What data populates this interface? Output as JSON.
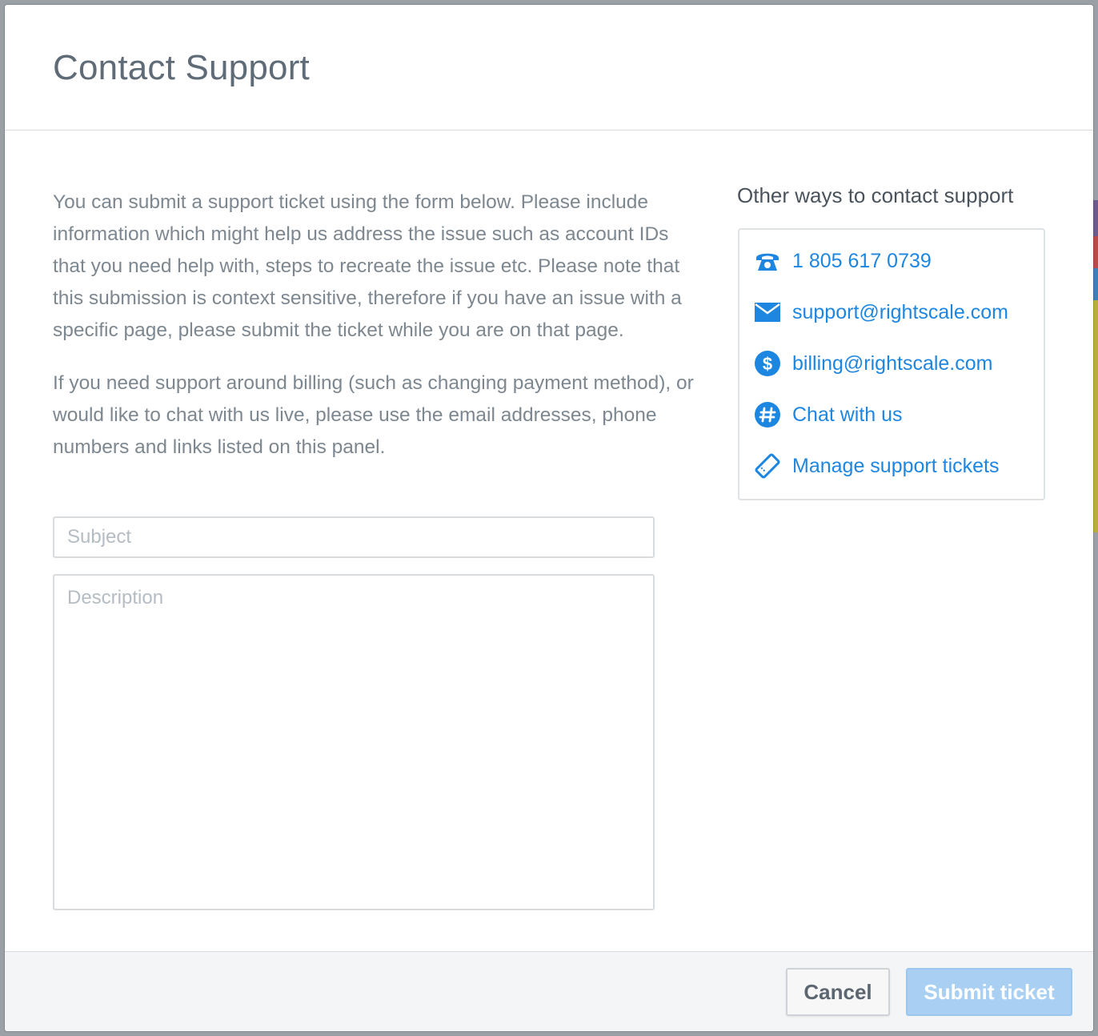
{
  "modal": {
    "title": "Contact Support"
  },
  "intro": {
    "paragraph1": "You can submit a support ticket using the form below. Please include information which might help us address the issue such as account IDs that you need help with, steps to recreate the issue etc. Please note that this submission is context sensitive, therefore if you have an issue with a specific page, please submit the ticket while you are on that page.",
    "paragraph2": "If you need support around billing (such as changing payment method), or would like to chat with us live, please use the email addresses, phone numbers and links listed on this panel."
  },
  "form": {
    "subject": {
      "placeholder": "Subject",
      "value": ""
    },
    "description": {
      "placeholder": "Description",
      "value": ""
    }
  },
  "sidebar": {
    "title": "Other ways to contact support",
    "items": [
      {
        "icon": "phone-icon",
        "label": "1 805 617 0739"
      },
      {
        "icon": "envelope-icon",
        "label": "support@rightscale.com"
      },
      {
        "icon": "dollar-icon",
        "label": "billing@rightscale.com"
      },
      {
        "icon": "chat-hashtag-icon",
        "label": "Chat with us"
      },
      {
        "icon": "ticket-icon",
        "label": "Manage support tickets"
      }
    ]
  },
  "footer": {
    "cancel_label": "Cancel",
    "submit_label": "Submit ticket"
  },
  "colors": {
    "link": "#1d86e0",
    "submit_disabled_bg": "#a9d0f3",
    "text_muted": "#7d8790"
  }
}
